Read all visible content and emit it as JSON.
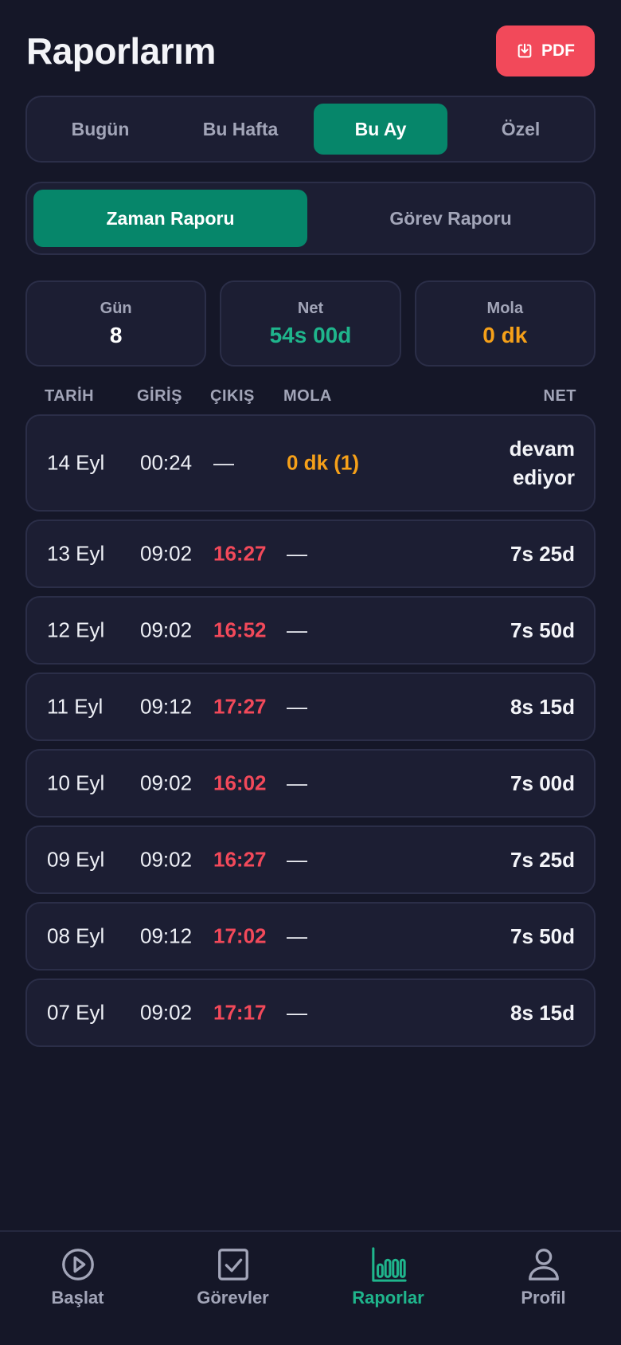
{
  "header": {
    "title": "Raporlarım",
    "pdf_label": "PDF"
  },
  "range_tabs": [
    {
      "label": "Bugün",
      "active": false
    },
    {
      "label": "Bu Hafta",
      "active": false
    },
    {
      "label": "Bu Ay",
      "active": true
    },
    {
      "label": "Özel",
      "active": false
    }
  ],
  "report_tabs": [
    {
      "label": "Zaman Raporu",
      "active": true
    },
    {
      "label": "Görev Raporu",
      "active": false
    }
  ],
  "stats": [
    {
      "label": "Gün",
      "value": "8",
      "color": "#ffffff"
    },
    {
      "label": "Net",
      "value": "54s 00d",
      "color": "#1fb58c"
    },
    {
      "label": "Mola",
      "value": "0 dk",
      "color": "#f5a019"
    }
  ],
  "table": {
    "headers": {
      "date": "TARİH",
      "in": "GİRİŞ",
      "out": "ÇIKIŞ",
      "break": "MOLA",
      "net": "NET"
    },
    "rows": [
      {
        "date": "14 Eyl",
        "in": "00:24",
        "out": "—",
        "break": "0 dk (1)",
        "net_line1": "devam",
        "net_line2": "ediyor"
      },
      {
        "date": "13 Eyl",
        "in": "09:02",
        "out": "16:27",
        "break": "—",
        "net": "7s 25d"
      },
      {
        "date": "12 Eyl",
        "in": "09:02",
        "out": "16:52",
        "break": "—",
        "net": "7s 50d"
      },
      {
        "date": "11 Eyl",
        "in": "09:12",
        "out": "17:27",
        "break": "—",
        "net": "8s 15d"
      },
      {
        "date": "10 Eyl",
        "in": "09:02",
        "out": "16:02",
        "break": "—",
        "net": "7s 00d"
      },
      {
        "date": "09 Eyl",
        "in": "09:02",
        "out": "16:27",
        "break": "—",
        "net": "7s 25d"
      },
      {
        "date": "08 Eyl",
        "in": "09:12",
        "out": "17:02",
        "break": "—",
        "net": "7s 50d"
      },
      {
        "date": "07 Eyl",
        "in": "09:02",
        "out": "17:17",
        "break": "—",
        "net": "8s 15d"
      }
    ]
  },
  "nav": [
    {
      "label": "Başlat",
      "icon": "play-circle-icon",
      "active": false
    },
    {
      "label": "Görevler",
      "icon": "checkbox-icon",
      "active": false
    },
    {
      "label": "Raporlar",
      "icon": "bar-chart-icon",
      "active": true
    },
    {
      "label": "Profil",
      "icon": "user-icon",
      "active": false
    }
  ],
  "colors": {
    "accent": "#06866a",
    "danger": "#f2495a",
    "warning": "#f5a019",
    "background": "#151728"
  }
}
